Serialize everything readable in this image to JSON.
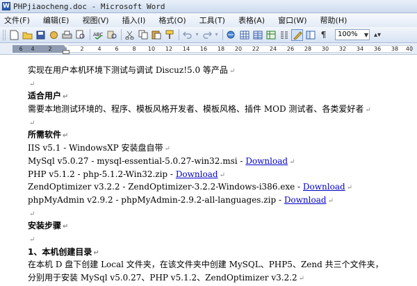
{
  "window": {
    "title": "PHPjiaocheng.doc - Microsoft Word"
  },
  "menus": [
    "文件(F)",
    "编辑(E)",
    "视图(V)",
    "插入(I)",
    "格式(O)",
    "工具(T)",
    "表格(A)",
    "窗口(W)",
    "帮助(H)"
  ],
  "toolbar": {
    "zoom": "100%"
  },
  "ruler": {
    "ticks": [
      "6",
      "4",
      "2",
      "",
      "2",
      "4",
      "6",
      "8",
      "10",
      "12",
      "14",
      "16",
      "18",
      "20",
      "22",
      "24",
      "26",
      "28",
      "30",
      "32",
      "34",
      "36",
      "38",
      "40"
    ]
  },
  "paragraph_mark": "↵",
  "doc": {
    "intro": "实现在用户本机环境下测试与调试 Discuz!5.0 等产品",
    "h_users": "适合用户",
    "users": "需要本地测试环境的、程序、模板风格开发者、模板风格、插件 MOD 测试者、各类爱好者",
    "h_software": "所需软件",
    "sw1": "IIS v5.1 - WindowsXP 安装盘自带",
    "sw2": "MySql v5.0.27 - mysql-essential-5.0.27-win32.msi - ",
    "sw3": "PHP v5.1.2 - php-5.1.2-Win32.zip - ",
    "sw4": "ZendOptimizer v3.2.2 - ZendOptimizer-3.2.2-Windows-i386.exe - ",
    "sw5": "phpMyAdmin v2.9.2 - phpMyAdmin-2.9.2-all-languages.zip - ",
    "download": "Download",
    "h_steps": "安装步骤",
    "h_step1": "1、本机创建目录",
    "step1a": "在本机 D 盘下创建 Local 文件夹，在该文件夹中创建 MySQL、PHP5、Zend 共三个文件夹，",
    "step1b": "分别用于安装 MySql v5.0.27、PHP v5.1.2、ZendOptimizer v3.2.2"
  }
}
